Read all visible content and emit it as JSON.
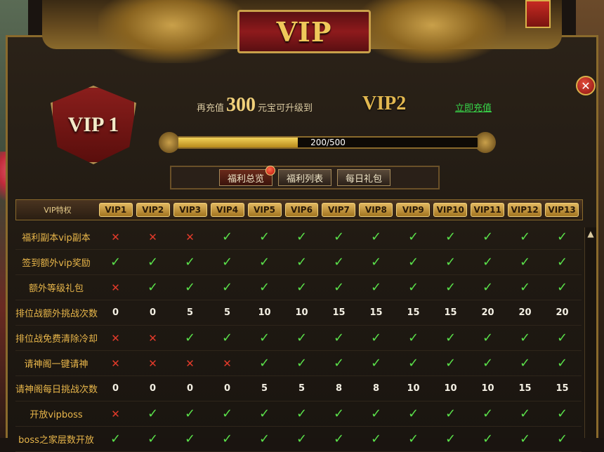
{
  "header": {
    "title": "VIP"
  },
  "current_vip": {
    "badge_label": "VIP 1"
  },
  "upgrade": {
    "prefix": "再充值",
    "amount": "300",
    "suffix": "元宝可升级到",
    "next_level": "VIP2",
    "recharge_link": "立即充值"
  },
  "progress": {
    "text": "200/500",
    "current": 200,
    "max": 500
  },
  "tabs": [
    {
      "label": "福利总览",
      "active": true,
      "has_dot": true
    },
    {
      "label": "福利列表",
      "active": false,
      "has_dot": false
    },
    {
      "label": "每日礼包",
      "active": false,
      "has_dot": false
    }
  ],
  "table": {
    "header_label": "VIP特权",
    "levels": [
      "VIP1",
      "VIP2",
      "VIP3",
      "VIP4",
      "VIP5",
      "VIP6",
      "VIP7",
      "VIP8",
      "VIP9",
      "VIP10",
      "VIP11",
      "VIP12",
      "VIP13"
    ],
    "rows": [
      {
        "label": "福利副本vip副本",
        "values": [
          "n",
          "n",
          "n",
          "y",
          "y",
          "y",
          "y",
          "y",
          "y",
          "y",
          "y",
          "y",
          "y"
        ]
      },
      {
        "label": "签到额外vip奖励",
        "values": [
          "y",
          "y",
          "y",
          "y",
          "y",
          "y",
          "y",
          "y",
          "y",
          "y",
          "y",
          "y",
          "y"
        ]
      },
      {
        "label": "额外等级礼包",
        "values": [
          "n",
          "y",
          "y",
          "y",
          "y",
          "y",
          "y",
          "y",
          "y",
          "y",
          "y",
          "y",
          "y"
        ]
      },
      {
        "label": "排位战额外挑战次数",
        "values": [
          "0",
          "0",
          "5",
          "5",
          "10",
          "10",
          "15",
          "15",
          "15",
          "15",
          "20",
          "20",
          "20"
        ]
      },
      {
        "label": "排位战免费清除冷却",
        "values": [
          "n",
          "n",
          "y",
          "y",
          "y",
          "y",
          "y",
          "y",
          "y",
          "y",
          "y",
          "y",
          "y"
        ]
      },
      {
        "label": "请神阁一键请神",
        "values": [
          "n",
          "n",
          "n",
          "n",
          "y",
          "y",
          "y",
          "y",
          "y",
          "y",
          "y",
          "y",
          "y"
        ]
      },
      {
        "label": "请神阁每日挑战次数",
        "values": [
          "0",
          "0",
          "0",
          "0",
          "5",
          "5",
          "8",
          "8",
          "10",
          "10",
          "10",
          "15",
          "15"
        ]
      },
      {
        "label": "开放vipboss",
        "values": [
          "n",
          "y",
          "y",
          "y",
          "y",
          "y",
          "y",
          "y",
          "y",
          "y",
          "y",
          "y",
          "y"
        ]
      },
      {
        "label": "boss之家层数开放",
        "values": [
          "y",
          "y",
          "y",
          "y",
          "y",
          "y",
          "y",
          "y",
          "y",
          "y",
          "y",
          "y",
          "y"
        ]
      }
    ]
  },
  "symbols": {
    "yes": "✓",
    "no": "✕"
  },
  "colors": {
    "accent_gold": "#e2b850",
    "link_green": "#38d84a",
    "no_red": "#e23a2a",
    "yes_green": "#5ae04a"
  }
}
